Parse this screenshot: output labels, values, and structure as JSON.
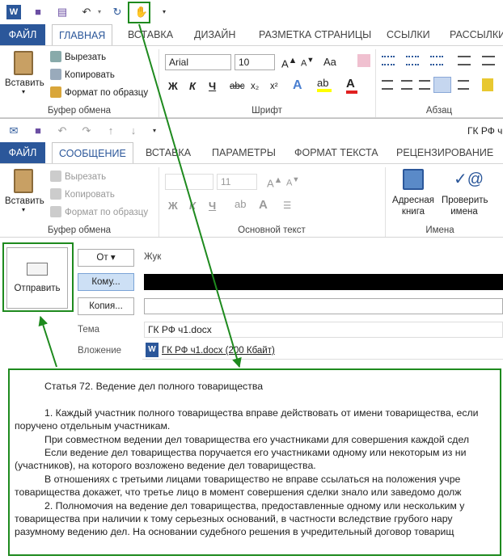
{
  "word": {
    "tabs": [
      "ФАЙЛ",
      "ГЛАВНАЯ",
      "ВСТАВКА",
      "ДИЗАЙН",
      "РАЗМЕТКА СТРАНИЦЫ",
      "ССЫЛКИ",
      "РАССЫЛКИ"
    ],
    "paste_label": "Вставить",
    "clipboard": {
      "cut": "Вырезать",
      "copy": "Копировать",
      "format": "Формат по образцу",
      "group": "Буфер обмена"
    },
    "font": {
      "name": "Arial",
      "size": "10",
      "group": "Шрифт",
      "bold": "Ж",
      "italic": "К",
      "underline": "Ч",
      "strike": "abc",
      "sub": "x₂",
      "sup": "x²"
    },
    "para_group": "Абзац"
  },
  "outlook": {
    "window_title": "ГК РФ ч",
    "tabs": [
      "ФАЙЛ",
      "СООБЩЕНИЕ",
      "ВСТАВКА",
      "ПАРАМЕТРЫ",
      "ФОРМАТ ТЕКСТА",
      "РЕЦЕНЗИРОВАНИЕ"
    ],
    "paste_label": "Вставить",
    "clipboard": {
      "cut": "Вырезать",
      "copy": "Копировать",
      "format": "Формат по образцу",
      "group": "Буфер обмена"
    },
    "font": {
      "size": "11",
      "group": "Основной текст"
    },
    "names": {
      "address_book": "Адресная книга",
      "check_names": "Проверить имена",
      "group": "Имена"
    },
    "send": "Отправить",
    "from_button": "От ▾",
    "from_value": "Жук",
    "to_button": "Кому...",
    "cc_button": "Копия...",
    "subject_label": "Тема",
    "subject_value": "ГК РФ ч1.docx",
    "attach_label": "Вложение",
    "attach_value": "ГК РФ ч1.docx (200 Кбайт)",
    "body_lines": [
      "Статья 72. Ведение дел полного товарищества",
      "",
      "1. Каждый участник полного товарищества вправе действовать от имени товарищества, если",
      "поручено отдельным участникам.",
      "При совместном ведении дел товарищества его участниками для совершения каждой сдел",
      "Если ведение дел товарищества поручается его участниками одному или некоторым из ни",
      "(участников), на которого возложено ведение дел товарищества.",
      "В отношениях с третьими лицами товарищество не вправе ссылаться на положения учре",
      "товарищества докажет, что третье лицо в момент совершения сделки знало или заведомо долж",
      "2. Полномочия на ведение дел товарищества, предоставленные одному или нескольким у",
      "товарищества при наличии к тому серьезных оснований, в частности вследствие грубого нару",
      "разумному ведению дел. На основании судебного решения в учредительный договор товарищ"
    ]
  },
  "colors": {
    "accent": "#2b579a",
    "annotation": "#1e8a1e"
  }
}
